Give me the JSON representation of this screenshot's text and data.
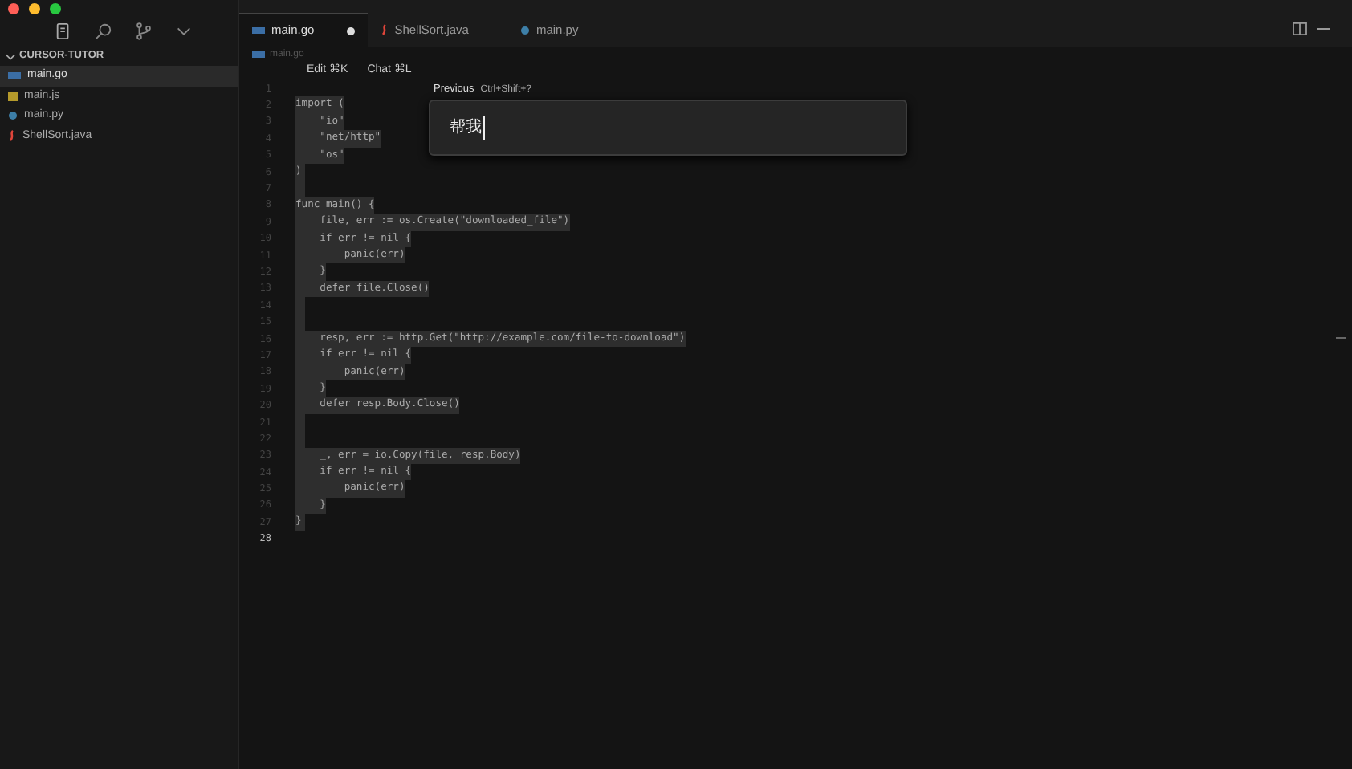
{
  "sidebar": {
    "title": "CURSOR-TUTOR",
    "files": [
      {
        "name": "main.go",
        "kind": "go",
        "selected": true
      },
      {
        "name": "main.js",
        "kind": "js",
        "selected": false
      },
      {
        "name": "main.py",
        "kind": "py",
        "selected": false
      },
      {
        "name": "ShellSort.java",
        "kind": "java",
        "selected": false
      }
    ]
  },
  "tabs": [
    {
      "label": "main.go",
      "kind": "go",
      "selected": true,
      "modified": true
    },
    {
      "label": "ShellSort.java",
      "kind": "java",
      "selected": false,
      "modified": false
    },
    {
      "label": "main.py",
      "kind": "py",
      "selected": false,
      "modified": false
    }
  ],
  "breadcrumb": "main.go",
  "hints": [
    "Edit ⌘K",
    "Chat ⌘L"
  ],
  "prompt": {
    "label": "Previous",
    "shortcut": "Ctrl+Shift+?",
    "value": "帮我"
  },
  "code": [
    {
      "number": "1",
      "selected": false
    },
    {
      "number": "2",
      "text": "import (",
      "selected": true
    },
    {
      "number": "3",
      "text": "    \"io\"",
      "selected": true
    },
    {
      "number": "4",
      "text": "    \"net/http\"",
      "selected": true
    },
    {
      "number": "5",
      "text": "    \"os\"",
      "selected": true
    },
    {
      "number": "6",
      "text": ")",
      "selected": true
    },
    {
      "number": "7",
      "selected": true
    },
    {
      "number": "8",
      "text": "func main() {",
      "selected": true
    },
    {
      "number": "9",
      "text": "    file, err := os.Create(\"downloaded_file\")",
      "selected": true
    },
    {
      "number": "10",
      "text": "    if err != nil {",
      "selected": true
    },
    {
      "number": "11",
      "text": "        panic(err)",
      "selected": true
    },
    {
      "number": "12",
      "text": "    }",
      "selected": true
    },
    {
      "number": "13",
      "text": "    defer file.Close()",
      "selected": true
    },
    {
      "number": "14",
      "selected": true
    },
    {
      "number": "15",
      "selected": true
    },
    {
      "number": "16",
      "text": "    resp, err := http.Get(\"http://example.com/file-to-download\")",
      "selected": true
    },
    {
      "number": "17",
      "text": "    if err != nil {",
      "selected": true
    },
    {
      "number": "18",
      "text": "        panic(err)",
      "selected": true
    },
    {
      "number": "19",
      "text": "    }",
      "selected": true
    },
    {
      "number": "20",
      "text": "    defer resp.Body.Close()",
      "selected": true
    },
    {
      "number": "21",
      "selected": true
    },
    {
      "number": "22",
      "selected": true
    },
    {
      "number": "23",
      "text": "    _, err = io.Copy(file, resp.Body)",
      "selected": true
    },
    {
      "number": "24",
      "text": "    if err != nil {",
      "selected": true
    },
    {
      "number": "25",
      "text": "        panic(err)",
      "selected": true
    },
    {
      "number": "26",
      "text": "    }",
      "selected": true
    },
    {
      "number": "27",
      "text": "}",
      "selected": true
    },
    {
      "number": "28",
      "selected": false
    }
  ]
}
